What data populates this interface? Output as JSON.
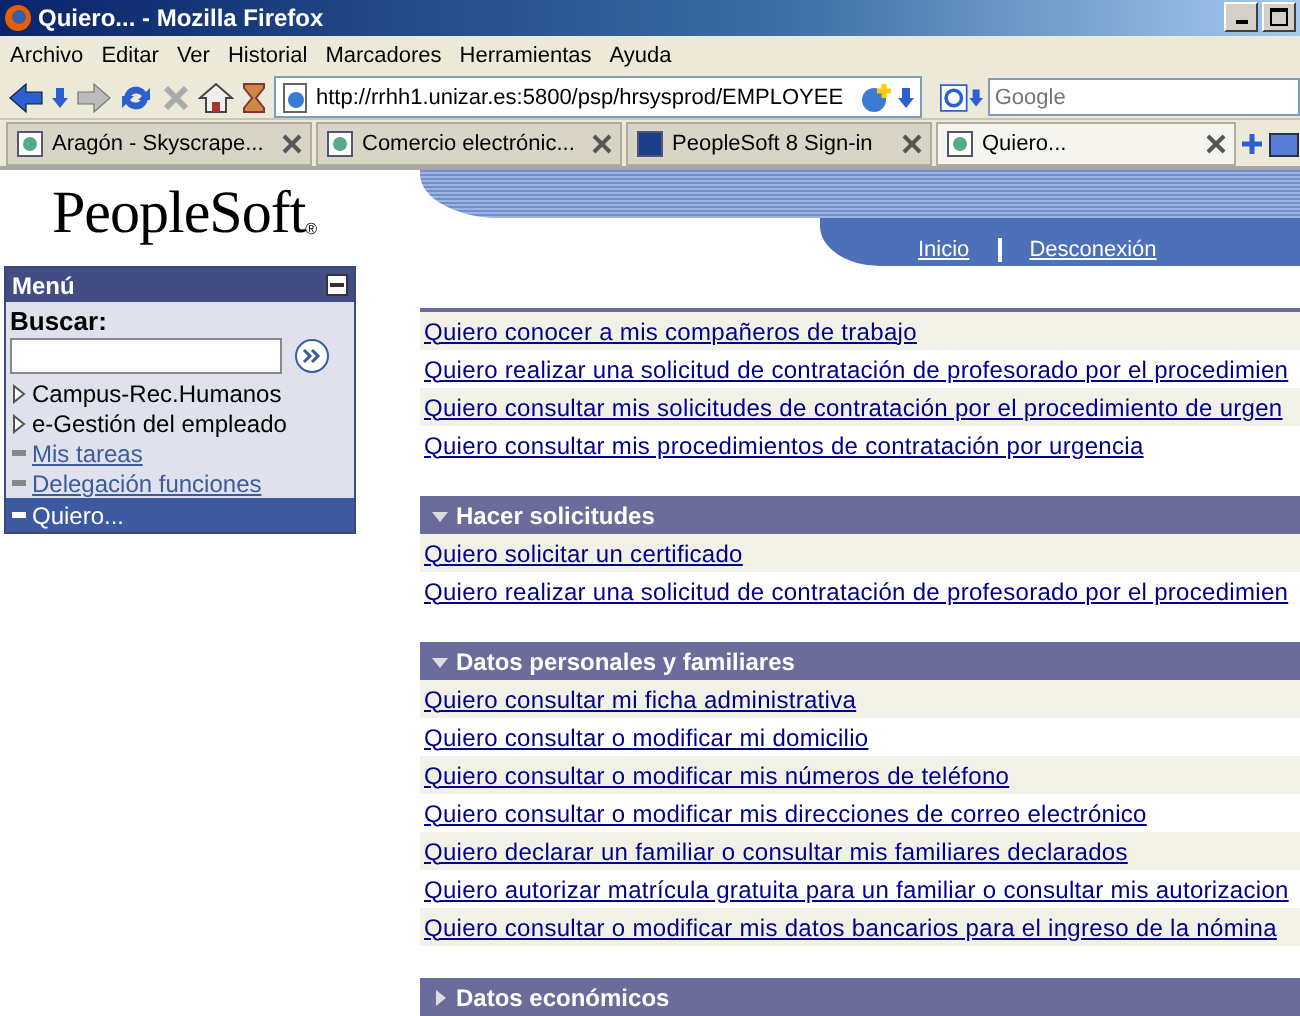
{
  "window": {
    "title": "Quiero... - Mozilla Firefox"
  },
  "menubar": [
    "Archivo",
    "Editar",
    "Ver",
    "Historial",
    "Marcadores",
    "Herramientas",
    "Ayuda"
  ],
  "address": {
    "value": "http://rrhh1.unizar.es:5800/psp/hrsysprod/EMPLOYEE"
  },
  "search": {
    "placeholder": "Google"
  },
  "tabs": [
    {
      "label": "Aragón - Skyscrape...",
      "selected": false
    },
    {
      "label": "Comercio electrónic...",
      "selected": false
    },
    {
      "label": "PeopleSoft 8 Sign-in",
      "selected": false
    },
    {
      "label": "Quiero...",
      "selected": true
    }
  ],
  "logo": "PeopleSoft",
  "logo_mark": "®",
  "header_links": [
    "Inicio",
    "Desconexión"
  ],
  "sidebar": {
    "title": "Menú",
    "search_label": "Buscar:",
    "items": [
      {
        "label": "Campus-Rec.Humanos",
        "kind": "folder",
        "selected": false
      },
      {
        "label": "e-Gestión del empleado",
        "kind": "folder",
        "selected": false
      },
      {
        "label": "Mis tareas",
        "kind": "link",
        "selected": false
      },
      {
        "label": "Delegación funciones",
        "kind": "link",
        "selected": false
      },
      {
        "label": "Quiero...",
        "kind": "link",
        "selected": true
      }
    ]
  },
  "sections": [
    {
      "links": [
        "Quiero conocer a mis compañeros de trabajo",
        "Quiero realizar una solicitud de contratación de profesorado por el procedimien",
        "Quiero consultar mis solicitudes de contratación por el procedimiento de urgen",
        "Quiero consultar mis procedimientos de contratación por urgencia"
      ]
    },
    {
      "title": "Hacer solicitudes",
      "expanded": true,
      "links": [
        "Quiero solicitar un certificado",
        "Quiero realizar una solicitud de contratación de profesorado por el procedimien"
      ]
    },
    {
      "title": "Datos personales y familiares",
      "expanded": true,
      "links": [
        "Quiero consultar mi ficha administrativa",
        "Quiero consultar o modificar mi domicilio",
        "Quiero consultar o modificar mis números de teléfono",
        "Quiero consultar o modificar mis direcciones de correo electrónico",
        "Quiero declarar un familiar o consultar mis familiares declarados",
        "Quiero autorizar matrícula gratuita para un familiar o consultar mis autorizacion",
        "Quiero consultar o modificar mis datos bancarios para el ingreso de la nómina"
      ]
    },
    {
      "title": "Datos económicos",
      "expanded": false
    }
  ]
}
